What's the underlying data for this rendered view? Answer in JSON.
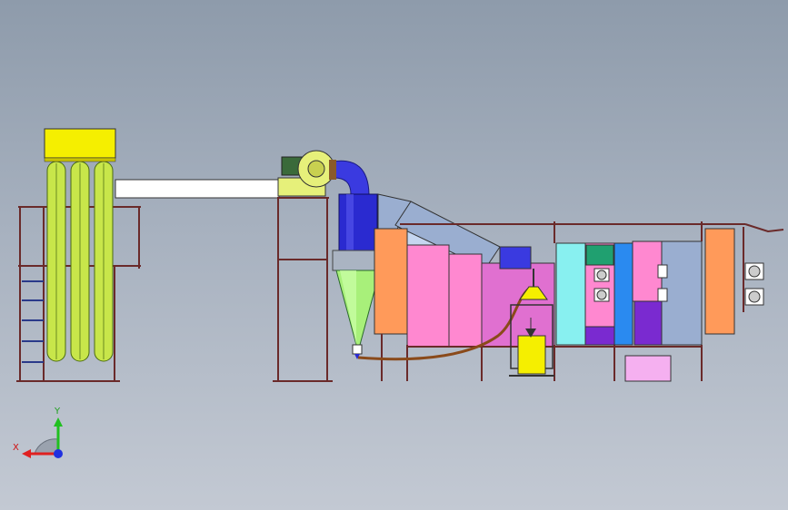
{
  "viewport": {
    "background_top": "#8e9bab",
    "background_bottom": "#c3c9d3"
  },
  "axis_triad": {
    "x_label": "X",
    "y_label": "Y",
    "x_color": "#e02020",
    "y_color": "#20c020",
    "z_color": "#2030e0"
  },
  "colors": {
    "filter_hood": "#f5ef00",
    "filter_bags": "#c8e64a",
    "duct": "#ffffff",
    "cyclone_body": "#2a2ad0",
    "cyclone_cone": "#a8f07a",
    "fan": "#e6f07a",
    "booth_orange": "#ff9a5a",
    "booth_pink": "#ff88d0",
    "booth_cyan": "#88f0f0",
    "booth_purple": "#7a2ad0",
    "booth_blue": "#2a8af0",
    "booth_green": "#20a070",
    "booth_grey_blue": "#9aaed0",
    "booth_magenta": "#e070d0",
    "feed_hopper": "#f5ef00",
    "frame": "#8a3a3a"
  }
}
